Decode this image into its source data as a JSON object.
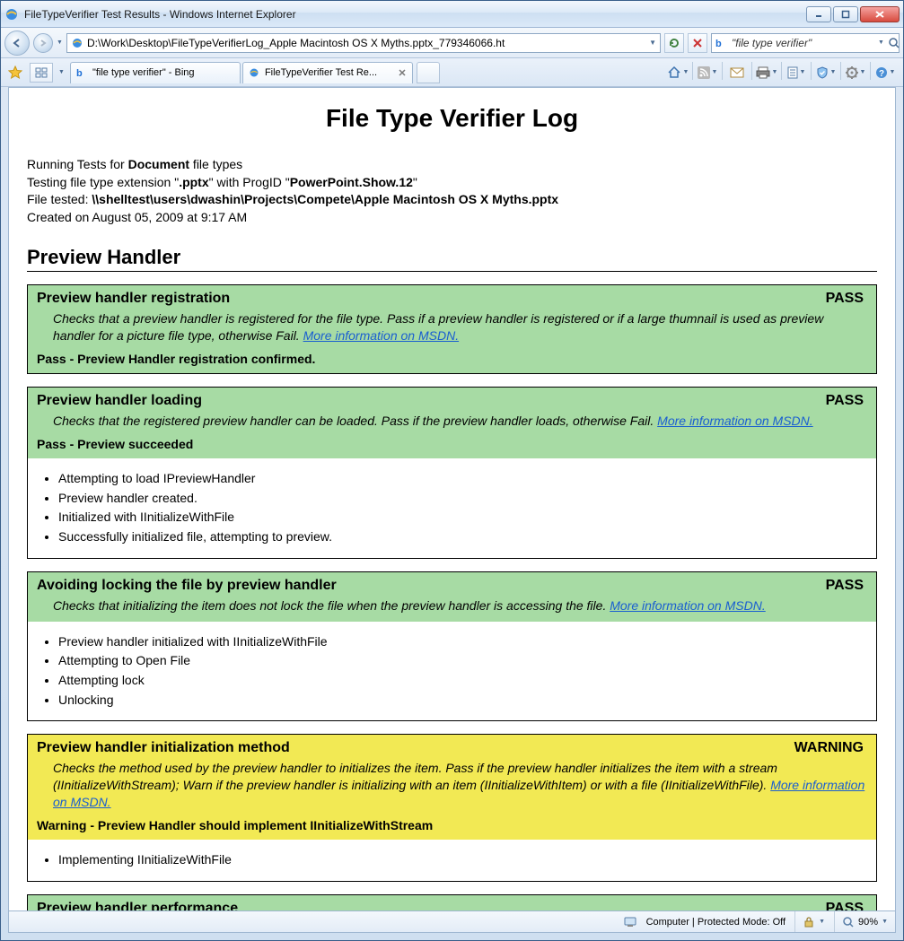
{
  "window": {
    "title": "FileTypeVerifier Test Results - Windows Internet Explorer"
  },
  "nav": {
    "address": "D:\\Work\\Desktop\\FileTypeVerifierLog_Apple Macintosh OS X Myths.pptx_779346066.ht",
    "search_value": "\"file type verifier\""
  },
  "tabs": [
    {
      "label": "\"file type verifier\" - Bing",
      "active": false
    },
    {
      "label": "FileTypeVerifier Test Re...",
      "active": true
    }
  ],
  "page": {
    "title": "File Type Verifier Log",
    "meta": {
      "line1_prefix": "Running Tests for ",
      "line1_bold": "Document",
      "line1_suffix": " file types",
      "line2_prefix": "Testing file type extension \"",
      "line2_ext": ".pptx",
      "line2_mid": "\" with ProgID \"",
      "line2_progid": "PowerPoint.Show.12",
      "line2_suffix": "\"",
      "line3_prefix": "File tested: ",
      "line3_path": "\\\\shelltest\\users\\dwashin\\Projects\\Compete\\Apple Macintosh OS X Myths.pptx",
      "line4": "Created on August 05, 2009 at 9:17 AM"
    },
    "section": "Preview Handler",
    "msdn_link": "More information on MSDN.",
    "tests": [
      {
        "name": "Preview handler registration",
        "status": "PASS",
        "status_class": "pass",
        "desc": "Checks that a preview handler is registered for the file type. Pass if a preview handler is registered or if a large thumnail is used as preview handler for a picture file type, otherwise Fail. ",
        "result": "Pass - Preview Handler registration confirmed.",
        "details": []
      },
      {
        "name": "Preview handler loading",
        "status": "PASS",
        "status_class": "pass",
        "desc": "Checks that the registered preview handler can be loaded. Pass if the preview handler loads, otherwise Fail. ",
        "result": "Pass - Preview succeeded",
        "details": [
          "Attempting to load IPreviewHandler",
          "Preview handler created.",
          "Initialized with IInitializeWithFile",
          "Successfully initialized file, attempting to preview."
        ]
      },
      {
        "name": "Avoiding locking the file by preview handler",
        "status": "PASS",
        "status_class": "pass",
        "desc": "Checks that initializing the item does not lock the file when the preview handler is accessing the file. ",
        "result": "",
        "details": [
          "Preview handler initialized with IInitializeWithFile",
          "Attempting to Open File",
          "Attempting lock",
          "Unlocking"
        ]
      },
      {
        "name": "Preview handler initialization method",
        "status": "WARNING",
        "status_class": "warn",
        "desc": "Checks the method used by the preview handler to initializes the item. Pass if the preview handler initializes the item with a stream (IInitializeWithStream); Warn if the preview handler is initializing with an item (IInitializeWithItem) or with a file (IInitializeWithFile). ",
        "result": "Warning - Preview Handler should implement IInitializeWithStream",
        "details": [
          "Implementing IInitializeWithFile"
        ]
      },
      {
        "name": "Preview handler performance",
        "status": "PASS",
        "status_class": "pass",
        "desc": "",
        "result": "",
        "details": []
      }
    ]
  },
  "statusbar": {
    "zone": "Computer | Protected Mode: Off",
    "zoom": "90%"
  }
}
